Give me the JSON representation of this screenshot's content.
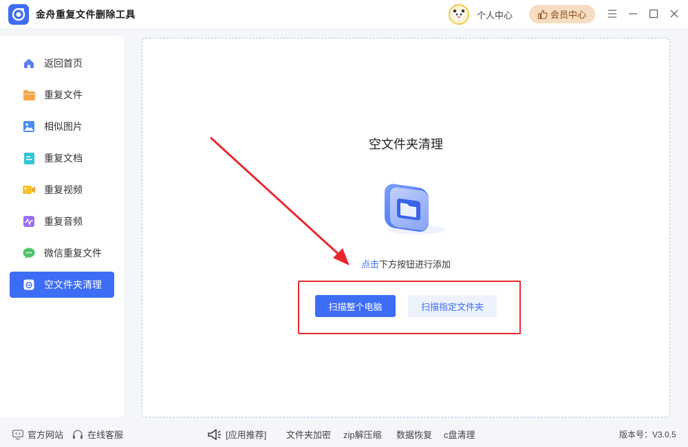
{
  "app": {
    "title": "金舟重复文件删除工具"
  },
  "header": {
    "personal_center": "个人中心",
    "vip_center": "会员中心"
  },
  "sidebar": {
    "items": [
      {
        "label": "返回首页",
        "icon": "home-icon",
        "color": "#5b7ef6"
      },
      {
        "label": "重复文件",
        "icon": "folder-icon",
        "color": "#f5a54a"
      },
      {
        "label": "相似图片",
        "icon": "image-icon",
        "color": "#4a8cf5"
      },
      {
        "label": "重复文档",
        "icon": "document-icon",
        "color": "#34c3d9"
      },
      {
        "label": "重复视频",
        "icon": "video-icon",
        "color": "#f5c32c"
      },
      {
        "label": "重复音频",
        "icon": "audio-icon",
        "color": "#9b6df5"
      },
      {
        "label": "微信重复文件",
        "icon": "wechat-icon",
        "color": "#4cc36b"
      },
      {
        "label": "空文件夹清理",
        "icon": "empty-folder-icon",
        "color": "#ffffff",
        "active": true
      }
    ]
  },
  "main": {
    "title": "空文件夹清理",
    "hint_highlight": "点击",
    "hint_rest": "下方按钮进行添加",
    "scan_all_label": "扫描整个电脑",
    "scan_folder_label": "扫描指定文件夹"
  },
  "footer": {
    "website": "官方网站",
    "support": "在线客服",
    "recommend": "[应用推荐]",
    "links": [
      "文件夹加密",
      "zip解压缩",
      "数据恢复",
      "c盘清理"
    ],
    "version": "版本号：V3.0.5"
  },
  "colors": {
    "accent": "#3d6cf5",
    "annotation_red": "#e8272c",
    "vip_bg": "#f6dcc0"
  }
}
